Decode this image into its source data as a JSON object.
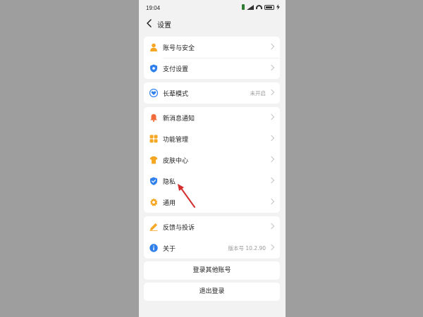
{
  "status_bar": {
    "time": "19:04"
  },
  "header": {
    "title": "设置"
  },
  "groups": [
    {
      "items": [
        {
          "label": "账号与安全",
          "icon": "person-icon",
          "color": "#f5a623"
        },
        {
          "label": "支付设置",
          "icon": "shield-payment-icon",
          "color": "#2f80ed"
        }
      ]
    },
    {
      "items": [
        {
          "label": "长辈模式",
          "value": "未开启",
          "icon": "heart-icon",
          "color": "#2f80ed"
        }
      ]
    },
    {
      "items": [
        {
          "label": "新消息通知",
          "icon": "bell-icon",
          "color": "#f26b3a"
        },
        {
          "label": "功能管理",
          "icon": "grid-icon",
          "color": "#f5a623"
        },
        {
          "label": "皮肤中心",
          "icon": "shirt-icon",
          "color": "#f5a623"
        },
        {
          "label": "隐私",
          "icon": "privacy-shield-icon",
          "color": "#2f80ed"
        },
        {
          "label": "通用",
          "icon": "gear-icon",
          "color": "#f5a623"
        }
      ]
    },
    {
      "items": [
        {
          "label": "反馈与投诉",
          "icon": "pencil-icon",
          "color": "#f5a623"
        },
        {
          "label": "关于",
          "value": "版本号 10.2.90",
          "icon": "info-icon",
          "color": "#2f80ed"
        }
      ]
    }
  ],
  "buttons": {
    "switch_account": "登录其他账号",
    "logout": "退出登录"
  },
  "colors": {
    "accent_blue": "#2f80ed",
    "accent_orange": "#f5a623",
    "annotation_red": "#d32f2f"
  }
}
